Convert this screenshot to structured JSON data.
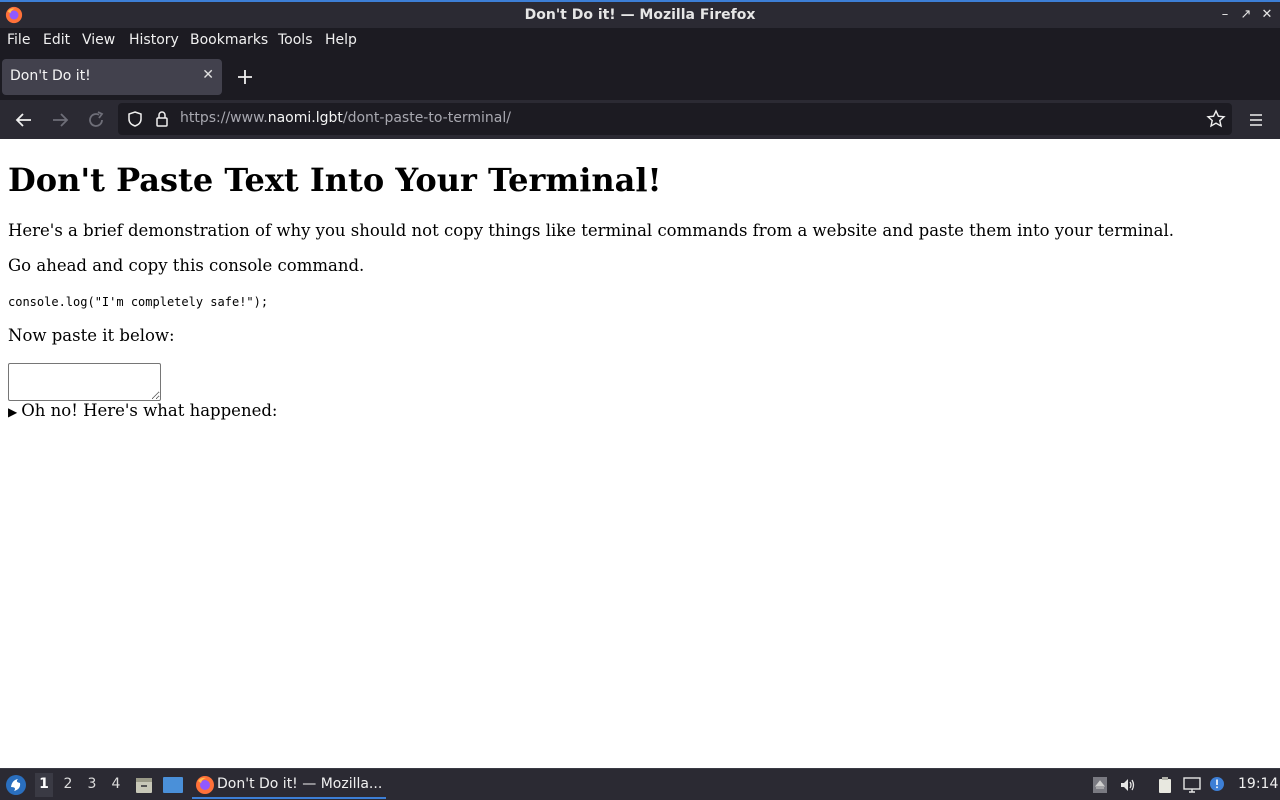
{
  "window": {
    "title": "Don't Do it! — Mozilla Firefox",
    "controls": [
      "minimize",
      "maximize",
      "close"
    ]
  },
  "menubar": {
    "items": [
      "File",
      "Edit",
      "View",
      "History",
      "Bookmarks",
      "Tools",
      "Help"
    ]
  },
  "tabs": [
    {
      "label": "Don't Do it!",
      "active": true
    }
  ],
  "navbar": {
    "url_prefix": "https://www.",
    "url_domain": "naomi.lgbt",
    "url_path": "/dont-paste-to-terminal/"
  },
  "page": {
    "heading": "Don't Paste Text Into Your Terminal!",
    "intro": "Here's a brief demonstration of why you should not copy things like terminal commands from a website and paste them into your terminal.",
    "instruction": "Go ahead and copy this console command.",
    "code": "console.log(\"I'm completely safe!\");",
    "paste_prompt": "Now paste it below:",
    "textarea_value": "",
    "details_summary": "Oh no! Here's what happened:"
  },
  "taskbar": {
    "workspaces": [
      "1",
      "2",
      "3",
      "4"
    ],
    "active_workspace": "1",
    "task_label": "Don't Do it! — Mozilla...",
    "clock": "19:14"
  },
  "colors": {
    "accent": "#3d7fd6",
    "chrome_dark": "#1c1b22",
    "chrome": "#2b2a33",
    "tab_active": "#42414d"
  }
}
